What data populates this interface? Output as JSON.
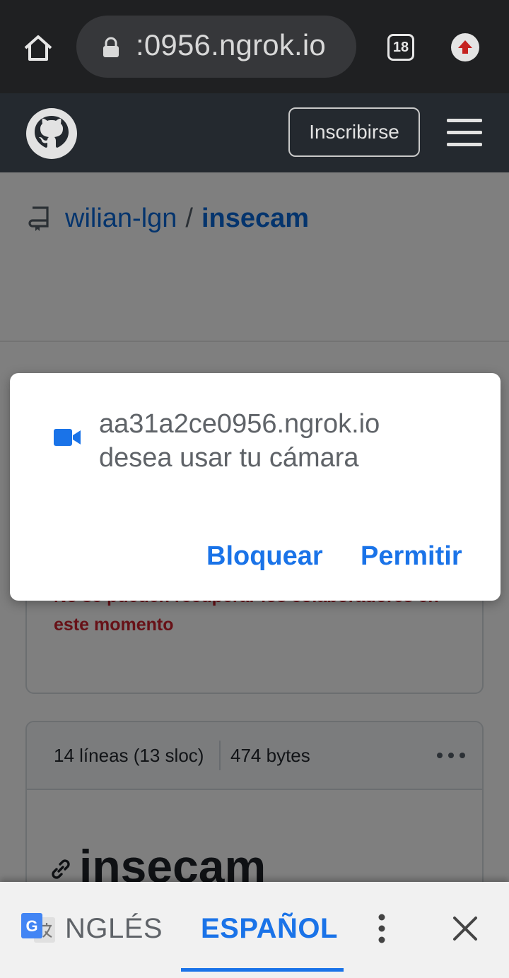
{
  "browser": {
    "url": "aa31a2ce0956.ngrok.io",
    "url_visible": ":0956.ngrok.io",
    "tab_count": "18"
  },
  "github": {
    "signup_label": "Inscribirse"
  },
  "repo": {
    "owner": "wilian-lgn",
    "separator": "/",
    "name": "insecam"
  },
  "contributors": {
    "error": "No se pueden recuperar los colaboradores en este momento"
  },
  "file": {
    "lines": "14 líneas (13 sloc)",
    "size": "474 bytes",
    "readme_title": "insecam"
  },
  "permission_dialog": {
    "origin": "aa31a2ce0956.ngrok.io",
    "message": "desea usar tu cámara",
    "block_label": "Bloquear",
    "allow_label": "Permitir"
  },
  "translate": {
    "source_lang": "NGLÉS",
    "target_lang": "ESPAÑOL"
  },
  "colors": {
    "accent": "#1a73e8",
    "link": "#0969da",
    "error": "#cf222e"
  }
}
